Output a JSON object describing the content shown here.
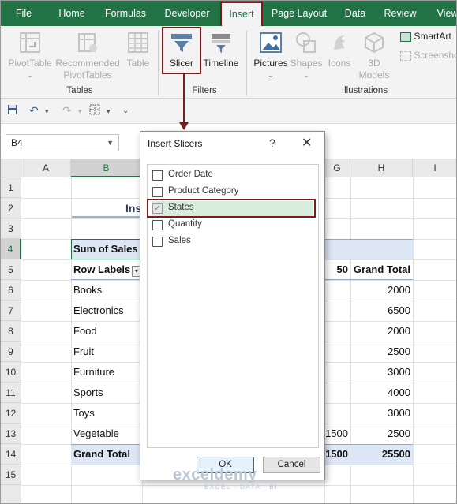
{
  "menu": {
    "tabs": [
      "File",
      "Home",
      "Formulas",
      "Developer",
      "Insert",
      "Page Layout",
      "Data",
      "Review",
      "View"
    ],
    "active": "Insert"
  },
  "ribbon": {
    "tables": {
      "pivot_line1": "PivotTable",
      "recommended_line1": "Recommended",
      "recommended_line2": "PivotTables",
      "table": "Table",
      "label": "Tables"
    },
    "filters": {
      "slicer": "Slicer",
      "timeline": "Timeline",
      "label": "Filters"
    },
    "illustrations": {
      "pictures": "Pictures",
      "shapes": "Shapes",
      "icons": "Icons",
      "models_line1": "3D",
      "models_line2": "Models",
      "smartart": "SmartArt",
      "screenshot": "Screensho",
      "label": "Illustrations"
    }
  },
  "name_box": "B4",
  "columns": [
    "A",
    "B",
    "G",
    "H",
    "I"
  ],
  "rows": [
    "1",
    "2",
    "3",
    "4",
    "5",
    "6",
    "7",
    "8",
    "9",
    "10",
    "11",
    "12",
    "13",
    "14",
    "15"
  ],
  "sheet": {
    "title": "Ins",
    "header_row": "Sum of Sales",
    "row_labels": "Row Labels",
    "g_header": "50",
    "grand_total_header": "Grand Total",
    "items": [
      {
        "label": "Books",
        "g": "",
        "total": "2000"
      },
      {
        "label": "Electronics",
        "g": "",
        "total": "6500"
      },
      {
        "label": "Food",
        "g": "",
        "total": "2000"
      },
      {
        "label": "Fruit",
        "g": "",
        "total": "2500"
      },
      {
        "label": "Furniture",
        "g": "",
        "total": "3000"
      },
      {
        "label": "Sports",
        "g": "",
        "total": "4000"
      },
      {
        "label": "Toys",
        "g": "",
        "total": "3000"
      },
      {
        "label": "Vegetable",
        "g": "1500",
        "total": "2500"
      }
    ],
    "grand_total": {
      "label": "Grand Total",
      "g": "1500",
      "total": "25500"
    }
  },
  "dialog": {
    "title": "Insert Slicers",
    "help": "?",
    "close": "✕",
    "fields": [
      {
        "label": "Order Date",
        "checked": false
      },
      {
        "label": "Product Category",
        "checked": false
      },
      {
        "label": "States",
        "checked": true
      },
      {
        "label": "Quantity",
        "checked": false
      },
      {
        "label": "Sales",
        "checked": false
      }
    ],
    "ok": "OK",
    "cancel": "Cancel"
  },
  "watermark": {
    "name": "exceldemy",
    "tagline": "EXCEL · DATA · BI"
  }
}
